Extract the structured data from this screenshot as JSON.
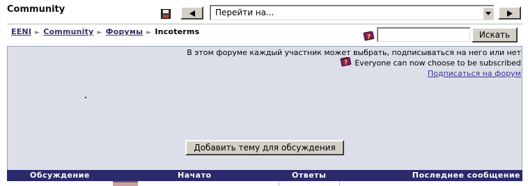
{
  "header": {
    "course_title": "Community",
    "jump_select_value": "Перейти на..."
  },
  "breadcrumb": [
    {
      "label": "EENI"
    },
    {
      "label": "Community"
    },
    {
      "label": "Форумы"
    },
    {
      "label": "Incoterms"
    }
  ],
  "search": {
    "button_label": "Искать",
    "value": ""
  },
  "forum": {
    "subscription_info": "В этом форуме каждый участник может выбрать, подписываться на него или нет",
    "subscription_info_en": "Everyone can now choose to be subscribed",
    "subscribe_link": "Подписаться на форум",
    "add_topic_label": "Добавить тему для обсуждения"
  },
  "table": {
    "columns": [
      "Обсуждение",
      "Начато",
      "Ответы",
      "Последнее сообщение"
    ]
  },
  "colors": {
    "table_header_bg": "#2b2a6b",
    "content_bg": "#dcdfe8",
    "link": "#333366"
  },
  "icons": [
    "save-icon",
    "arrow-left-icon",
    "arrow-right-icon",
    "chevron-down-icon",
    "help-book-icon"
  ]
}
